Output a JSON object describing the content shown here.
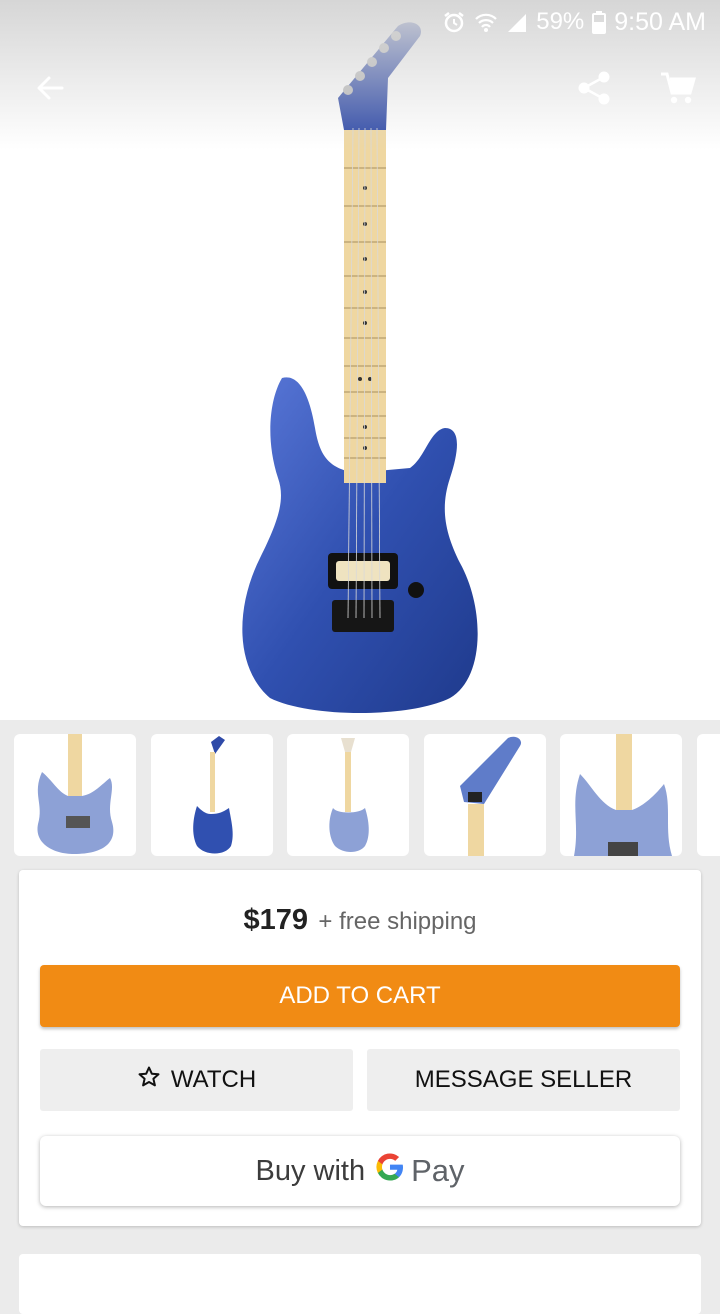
{
  "status_bar": {
    "battery": "59%",
    "time": "9:50 AM"
  },
  "toolbar": {
    "back_icon": "arrow-back-icon",
    "share_icon": "share-icon",
    "cart_icon": "cart-icon"
  },
  "product": {
    "price": "$179",
    "shipping": "+ free shipping",
    "body_color": "#3a56b4"
  },
  "actions": {
    "add_to_cart": "ADD TO CART",
    "watch": "WATCH",
    "message_seller": "MESSAGE SELLER",
    "buy_with": "Buy with",
    "pay": "Pay"
  },
  "colors": {
    "accent": "#f18b14"
  }
}
